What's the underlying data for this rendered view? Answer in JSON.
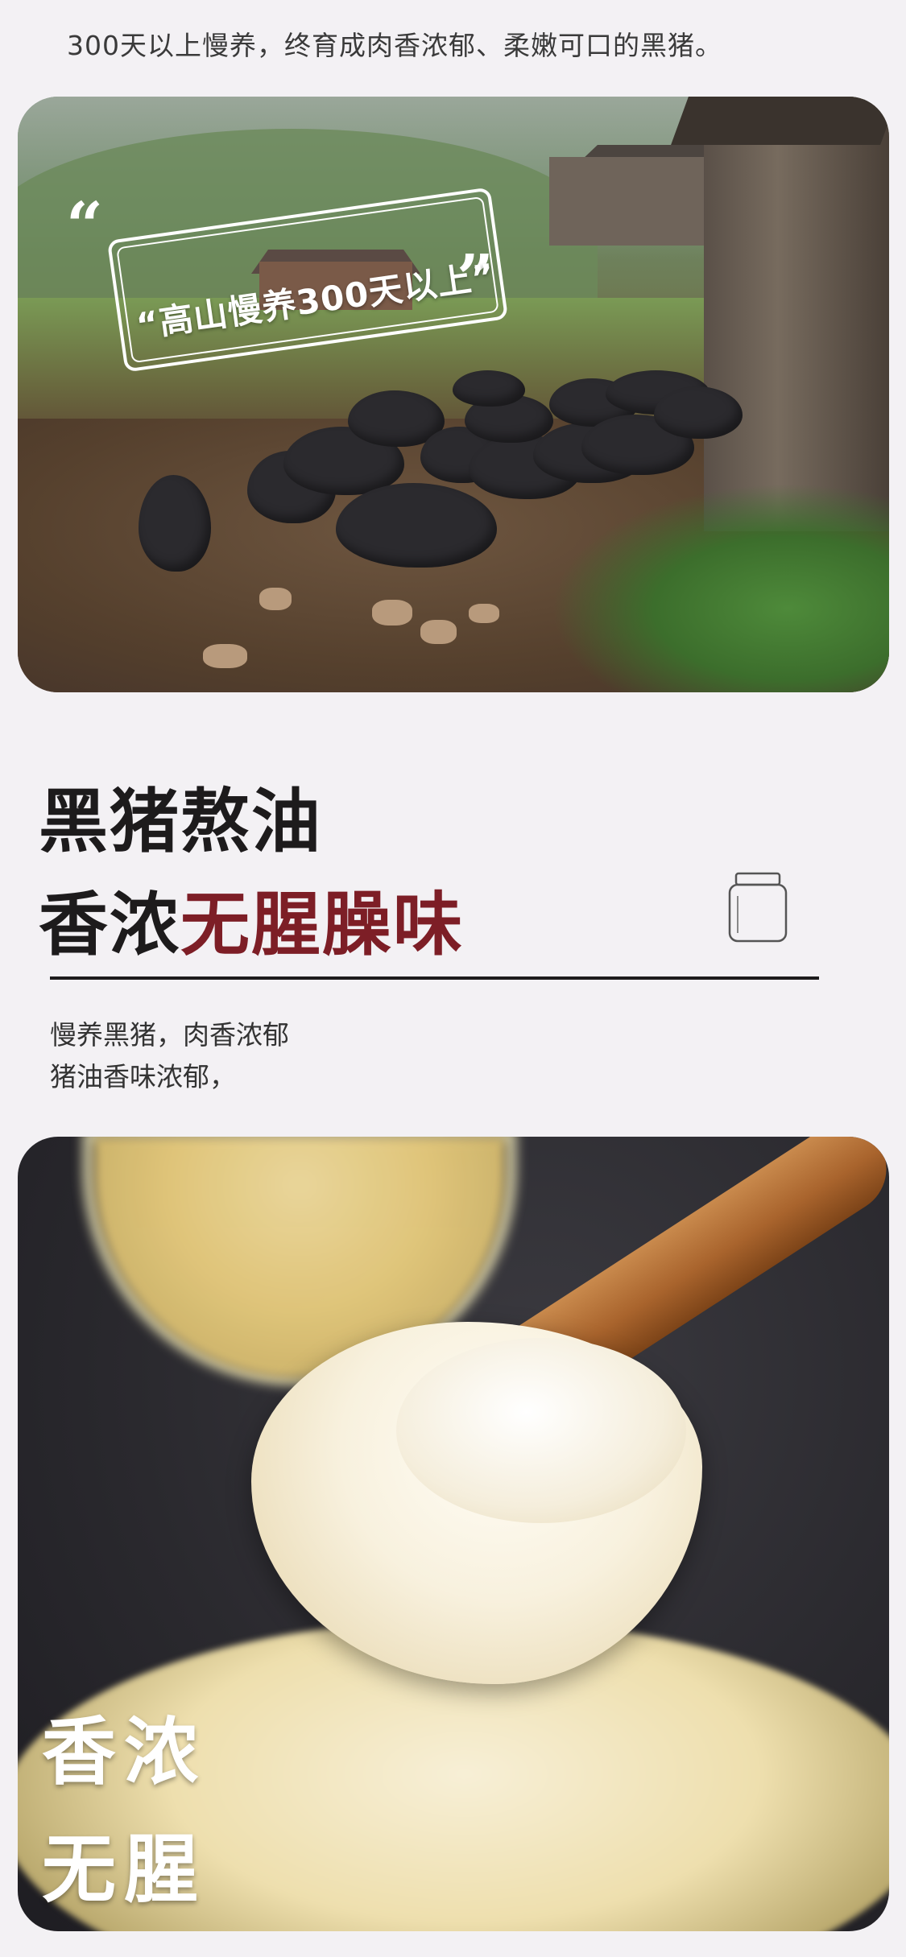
{
  "intro": {
    "text": "300天以上慢养，终育成肉香浓郁、柔嫩可口的黑猪。"
  },
  "farm_photo": {
    "badge_text": "“高山慢养300天以上”",
    "icons": [
      "quote-open-icon",
      "quote-close-icon"
    ]
  },
  "title": {
    "line1": "黑猪熬油",
    "line2_prefix": "香浓",
    "line2_highlight": "无腥臊味",
    "highlight_color": "#7d1e26",
    "icon": "jar-icon"
  },
  "description": {
    "line1": "慢养黑猪，肉香浓郁",
    "line2": "猪油香味浓郁，"
  },
  "lard_photo": {
    "caption_line1": "香浓",
    "caption_line2": "无腥"
  }
}
